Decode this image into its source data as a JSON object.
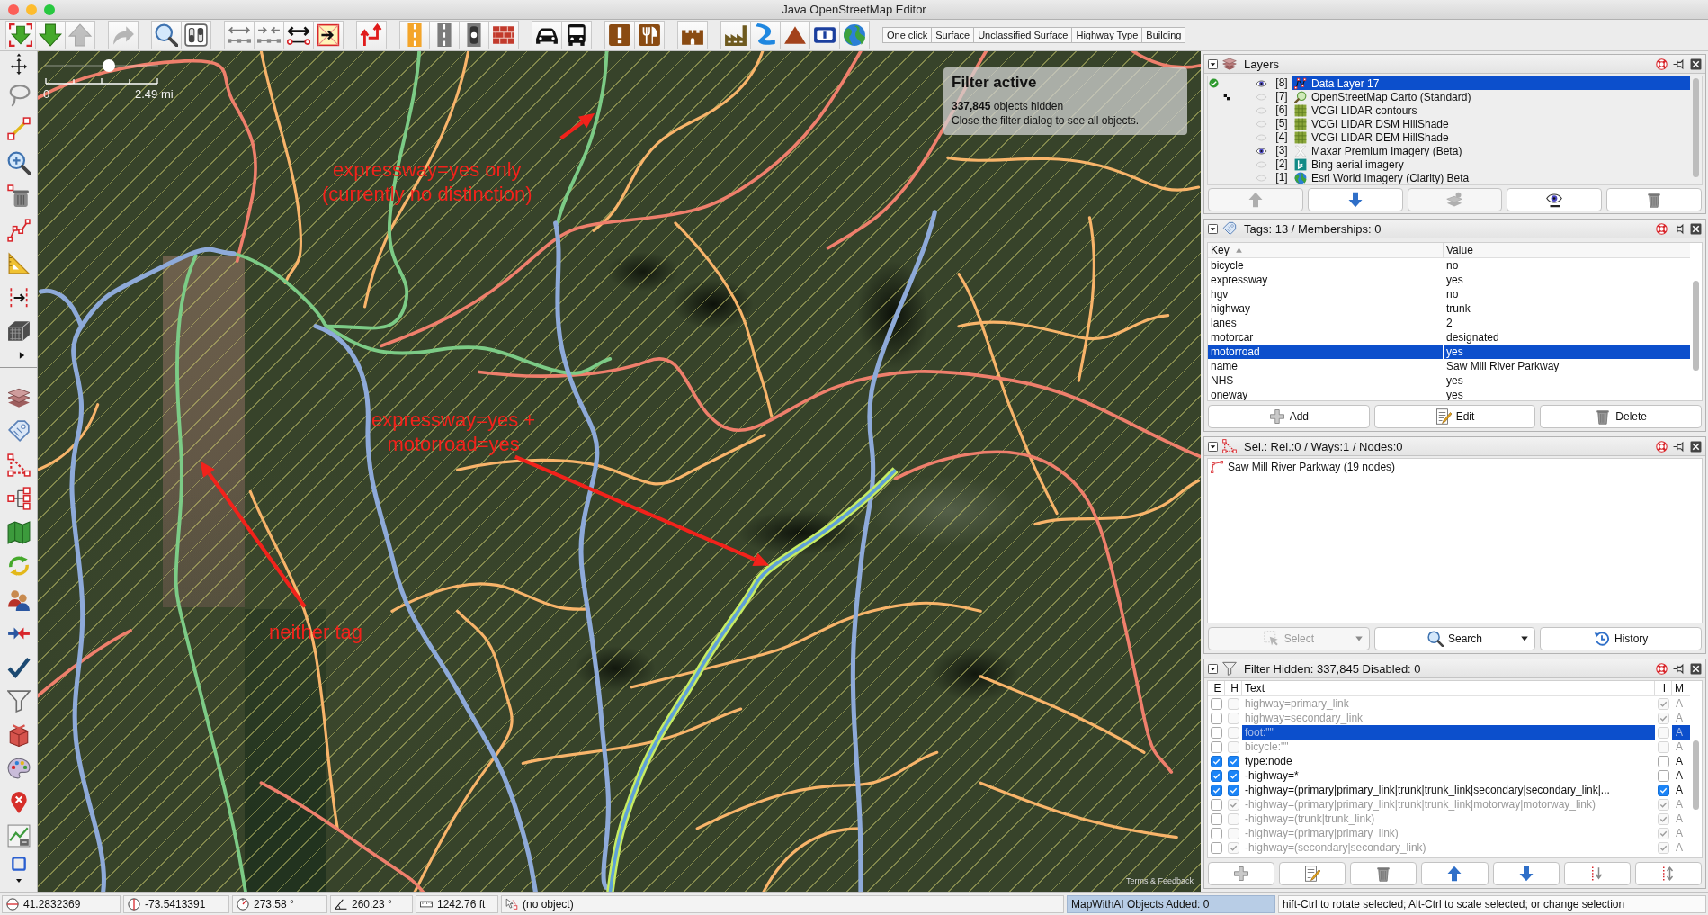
{
  "window": {
    "title": "Java OpenStreetMap Editor"
  },
  "toolbar": {
    "icon_buttons": [
      {
        "disabled": false
      },
      {
        "disabled": false
      },
      {
        "disabled": true
      },
      {
        "disabled": true
      },
      {
        "disabled": false
      },
      {
        "disabled": false
      },
      {
        "disabled": false
      },
      {
        "disabled": false
      },
      {
        "disabled": false
      },
      {
        "disabled": false
      },
      {
        "disabled": false
      },
      {
        "disabled": false
      },
      {
        "disabled": false
      },
      {
        "disabled": false
      },
      {
        "disabled": false
      },
      {
        "disabled": false
      },
      {
        "disabled": false
      },
      {
        "disabled": false
      },
      {
        "disabled": false
      },
      {
        "disabled": false
      },
      {
        "disabled": false
      },
      {
        "disabled": false
      },
      {
        "disabled": false
      },
      {
        "disabled": false
      },
      {
        "disabled": false
      }
    ],
    "text_buttons": [
      "One click",
      "Surface",
      "Unclassified Surface",
      "Highway Type",
      "Building"
    ]
  },
  "map": {
    "zoom_slider": {
      "level": 0.56
    },
    "scale": {
      "start": "0",
      "end": "2.49 mi"
    },
    "filter_notice": {
      "title": "Filter active",
      "count": "**337,845** objects hidden",
      "hint": "Close the filter dialog to see all objects."
    },
    "annotations": [
      {
        "lines": [
          "expressway=yes only",
          "(currently no distinction)"
        ]
      },
      {
        "lines": [
          "expressway=yes +",
          "motorroad=yes"
        ]
      },
      {
        "lines": [
          "neither tag"
        ]
      }
    ],
    "attribution": "Terms & Feedback"
  },
  "layers_panel": {
    "title": "Layers",
    "layers": [
      {
        "index": "[8]",
        "name": "Data Layer 17",
        "kind": "data",
        "active": true,
        "native_scale": false,
        "visible": true,
        "selected": true
      },
      {
        "index": "[7]",
        "name": "OpenStreetMap Carto (Standard)",
        "kind": "carto",
        "active": false,
        "native_scale": true,
        "visible": false,
        "selected": false
      },
      {
        "index": "[6]",
        "name": "VCGI LIDAR contours",
        "kind": "wms",
        "active": false,
        "native_scale": false,
        "visible": false,
        "selected": false
      },
      {
        "index": "[5]",
        "name": "VCGI LIDAR DSM HillShade",
        "kind": "wms",
        "active": false,
        "native_scale": false,
        "visible": false,
        "selected": false
      },
      {
        "index": "[4]",
        "name": "VCGI LIDAR DEM HillShade",
        "kind": "wms",
        "active": false,
        "native_scale": false,
        "visible": false,
        "selected": false
      },
      {
        "index": "[3]",
        "name": "Maxar Premium Imagery (Beta)",
        "kind": "maxar",
        "active": false,
        "native_scale": false,
        "visible": true,
        "selected": false
      },
      {
        "index": "[2]",
        "name": "Bing aerial imagery",
        "kind": "bing",
        "active": false,
        "native_scale": false,
        "visible": false,
        "selected": false
      },
      {
        "index": "[1]",
        "name": "Esri World Imagery (Clarity) Beta",
        "kind": "esri",
        "active": false,
        "native_scale": false,
        "visible": false,
        "selected": false
      }
    ],
    "buttons": [
      {
        "disabled": true
      },
      {
        "disabled": false
      },
      {
        "disabled": true
      },
      {
        "disabled": false
      },
      {
        "disabled": false
      }
    ]
  },
  "tags_panel": {
    "title": "Tags: 13 / Memberships: 0",
    "columns": [
      {
        "label": "Key",
        "sorted": true
      },
      {
        "label": "Value",
        "sorted": false
      }
    ],
    "rows": [
      {
        "key": "bicycle",
        "value": "no",
        "selected": false
      },
      {
        "key": "expressway",
        "value": "yes",
        "selected": false
      },
      {
        "key": "hgv",
        "value": "no",
        "selected": false
      },
      {
        "key": "highway",
        "value": "trunk",
        "selected": false
      },
      {
        "key": "lanes",
        "value": "2",
        "selected": false
      },
      {
        "key": "motorcar",
        "value": "designated",
        "selected": false
      },
      {
        "key": "motorroad",
        "value": "yes",
        "selected": true
      },
      {
        "key": "name",
        "value": "Saw Mill River Parkway",
        "selected": false
      },
      {
        "key": "NHS",
        "value": "yes",
        "selected": false
      },
      {
        "key": "oneway",
        "value": "yes",
        "selected": false
      }
    ],
    "buttons": [
      {
        "label": "Add",
        "kind": "add"
      },
      {
        "label": "Edit",
        "kind": "edit"
      },
      {
        "label": "Delete",
        "kind": "delete"
      }
    ]
  },
  "selection_panel": {
    "title": "Sel.: Rel.:0 / Ways:1 / Nodes:0",
    "items": [
      {
        "text": "Saw Mill River Parkway (19 nodes)",
        "kind": "way",
        "selected": false
      }
    ],
    "buttons": [
      {
        "label": "Select",
        "kind": "select",
        "disabled": true,
        "dropdown": true
      },
      {
        "label": "Search",
        "kind": "search",
        "disabled": false,
        "dropdown": true
      },
      {
        "label": "History",
        "kind": "history",
        "disabled": false,
        "dropdown": false
      }
    ]
  },
  "filter_panel": {
    "title": "Filter Hidden: 337,845 Disabled: 0",
    "columns": [
      "E",
      "H",
      "Text",
      "I",
      "M"
    ],
    "rows": [
      {
        "enabled": false,
        "hiding": false,
        "text": "highway=primary_link",
        "inverted": true,
        "mode": "A",
        "selected": false
      },
      {
        "enabled": false,
        "hiding": false,
        "text": "highway=secondary_link",
        "inverted": true,
        "mode": "A",
        "selected": false
      },
      {
        "enabled": false,
        "hiding": false,
        "text": "foot:\"\"",
        "inverted": false,
        "mode": "A",
        "selected": true
      },
      {
        "enabled": false,
        "hiding": false,
        "text": "bicycle:\"\"",
        "inverted": false,
        "mode": "A",
        "selected": false
      },
      {
        "enabled": true,
        "hiding": true,
        "text": "type:node",
        "inverted": false,
        "mode": "A",
        "selected": false
      },
      {
        "enabled": true,
        "hiding": true,
        "text": "-highway=*",
        "inverted": false,
        "mode": "A",
        "selected": false
      },
      {
        "enabled": true,
        "hiding": true,
        "text": "-highway=(primary|primary_link|trunk|trunk_link|secondary|secondary_link|...",
        "inverted": true,
        "mode": "A",
        "selected": false
      },
      {
        "enabled": false,
        "hiding": true,
        "text": "-highway=(primary|primary_link|trunk|trunk_link|motorway|motorway_link)",
        "inverted": true,
        "mode": "A",
        "selected": false
      },
      {
        "enabled": false,
        "hiding": false,
        "text": "-highway=(trunk|trunk_link)",
        "inverted": true,
        "mode": "A",
        "selected": false
      },
      {
        "enabled": false,
        "hiding": false,
        "text": "-highway=(primary|primary_link)",
        "inverted": true,
        "mode": "A",
        "selected": false
      },
      {
        "enabled": false,
        "hiding": true,
        "text": "-highway=(secondary|secondary_link)",
        "inverted": true,
        "mode": "A",
        "selected": false
      }
    ]
  },
  "status_bar": [
    {
      "kind": "lat",
      "text": "41.2832369"
    },
    {
      "kind": "lon",
      "text": "-73.5413391"
    },
    {
      "kind": "heading",
      "text": "273.58 °"
    },
    {
      "kind": "angle",
      "text": "260.23 °"
    },
    {
      "kind": "distance",
      "text": "1242.76 ft"
    },
    {
      "kind": "object",
      "text": "(no object)"
    },
    {
      "kind": "counter",
      "text": "MapWithAI Objects Added: 0"
    },
    {
      "kind": "help",
      "text": "hift-Ctrl to rotate selected; Alt-Ctrl to scale selected; or change selection"
    }
  ]
}
